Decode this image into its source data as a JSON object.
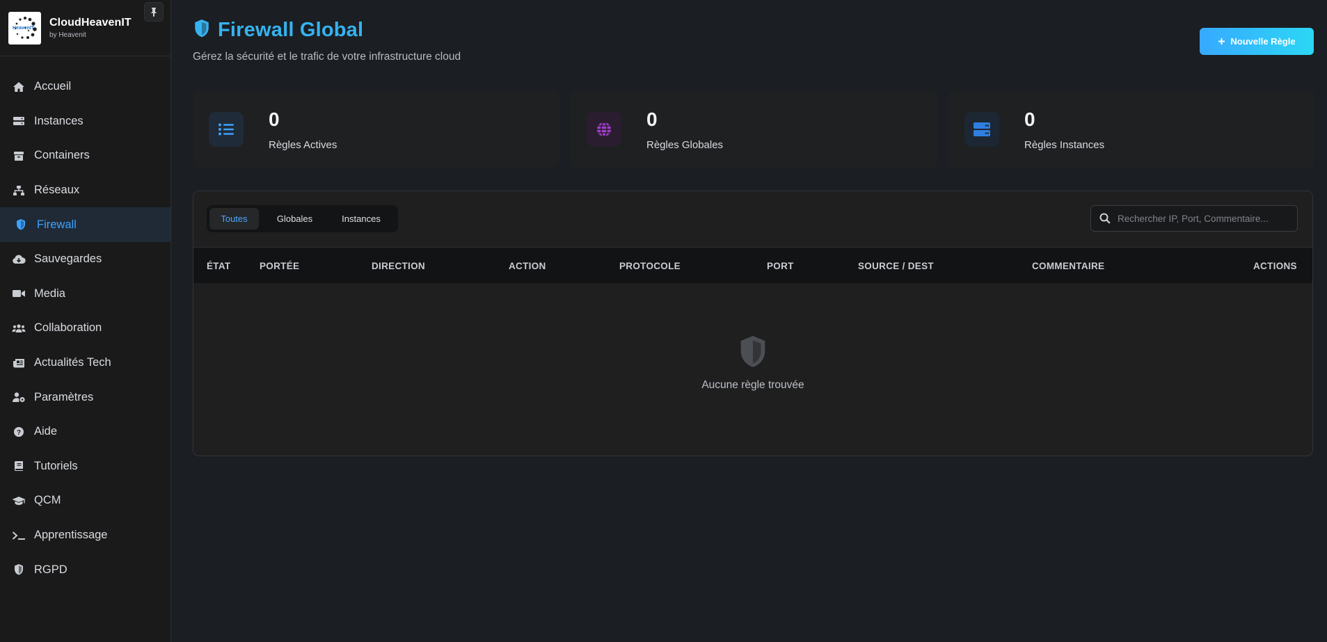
{
  "brand": {
    "name": "CloudHeavenIT",
    "subtitle": "by Heavenit",
    "logo_text": "HeavenIT"
  },
  "sidebar": {
    "items": [
      {
        "label": "Accueil",
        "icon": "home-icon"
      },
      {
        "label": "Instances",
        "icon": "server-icon"
      },
      {
        "label": "Containers",
        "icon": "box-icon"
      },
      {
        "label": "Réseaux",
        "icon": "network-icon"
      },
      {
        "label": "Firewall",
        "icon": "shield-icon",
        "active": true
      },
      {
        "label": "Sauvegardes",
        "icon": "cloud-download-icon"
      },
      {
        "label": "Media",
        "icon": "video-icon"
      },
      {
        "label": "Collaboration",
        "icon": "users-icon"
      },
      {
        "label": "Actualités Tech",
        "icon": "newspaper-icon"
      },
      {
        "label": "Paramètres",
        "icon": "user-cog-icon"
      },
      {
        "label": "Aide",
        "icon": "question-icon"
      },
      {
        "label": "Tutoriels",
        "icon": "book-icon"
      },
      {
        "label": "QCM",
        "icon": "graduation-cap-icon"
      },
      {
        "label": "Apprentissage",
        "icon": "terminal-icon"
      },
      {
        "label": "RGPD",
        "icon": "shield-half-icon"
      }
    ]
  },
  "header": {
    "title": "Firewall Global",
    "subtitle": "Gérez la sécurité et le trafic de votre infrastructure cloud",
    "new_rule_label": "Nouvelle Règle"
  },
  "stats": [
    {
      "value": "0",
      "label": "Règles Actives",
      "icon": "list-icon",
      "color": "#3ea2ff",
      "bg": "#1f2b38"
    },
    {
      "value": "0",
      "label": "Règles Globales",
      "icon": "globe-icon",
      "color": "#a23ec9",
      "bg": "#2a1d30"
    },
    {
      "value": "0",
      "label": "Règles Instances",
      "icon": "server-icon",
      "color": "#2f7fe0",
      "bg": "#1d2733"
    }
  ],
  "filters": {
    "tabs": [
      "Toutes",
      "Globales",
      "Instances"
    ],
    "active": "Toutes",
    "search_placeholder": "Rechercher IP, Port, Commentaire..."
  },
  "table": {
    "columns": [
      "ÉTAT",
      "PORTÉE",
      "DIRECTION",
      "ACTION",
      "PROTOCOLE",
      "PORT",
      "SOURCE / DEST",
      "COMMENTAIRE",
      "ACTIONS"
    ],
    "rows": [],
    "empty_text": "Aucune règle trouvée"
  },
  "colors": {
    "accent": "#35b3f0",
    "active_nav": "#3ea2ff",
    "background": "#1b1e22"
  }
}
